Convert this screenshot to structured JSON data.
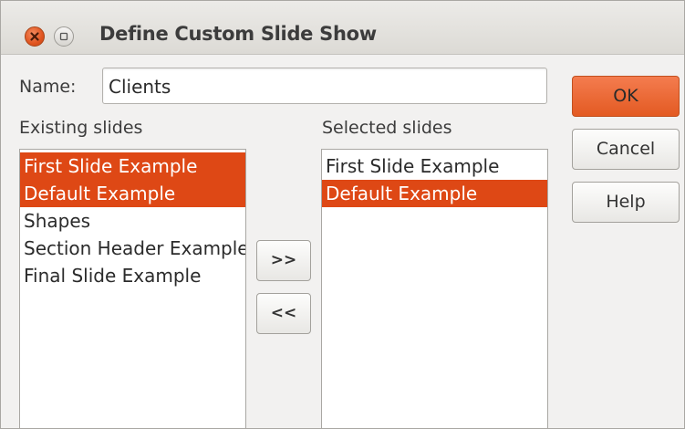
{
  "window": {
    "title": "Define Custom Slide Show",
    "close_icon": "close-icon",
    "minimize_icon": "minimize-icon"
  },
  "name": {
    "label": "Name:",
    "value": "Clients"
  },
  "existing": {
    "label": "Existing slides",
    "items": [
      {
        "label": "First Slide Example",
        "selected": true
      },
      {
        "label": "Default Example",
        "selected": true
      },
      {
        "label": "Shapes",
        "selected": false
      },
      {
        "label": "Section Header Example",
        "selected": false
      },
      {
        "label": "Final Slide Example",
        "selected": false
      }
    ]
  },
  "selected": {
    "label": "Selected slides",
    "items": [
      {
        "label": "First Slide Example",
        "selected": false
      },
      {
        "label": "Default Example",
        "selected": true
      }
    ]
  },
  "buttons": {
    "ok": "OK",
    "cancel": "Cancel",
    "help": "Help",
    "add": ">>",
    "remove": "<<"
  },
  "colors": {
    "accent": "#de4815",
    "ok_button": "#e35a22",
    "background": "#f2f1f0"
  }
}
